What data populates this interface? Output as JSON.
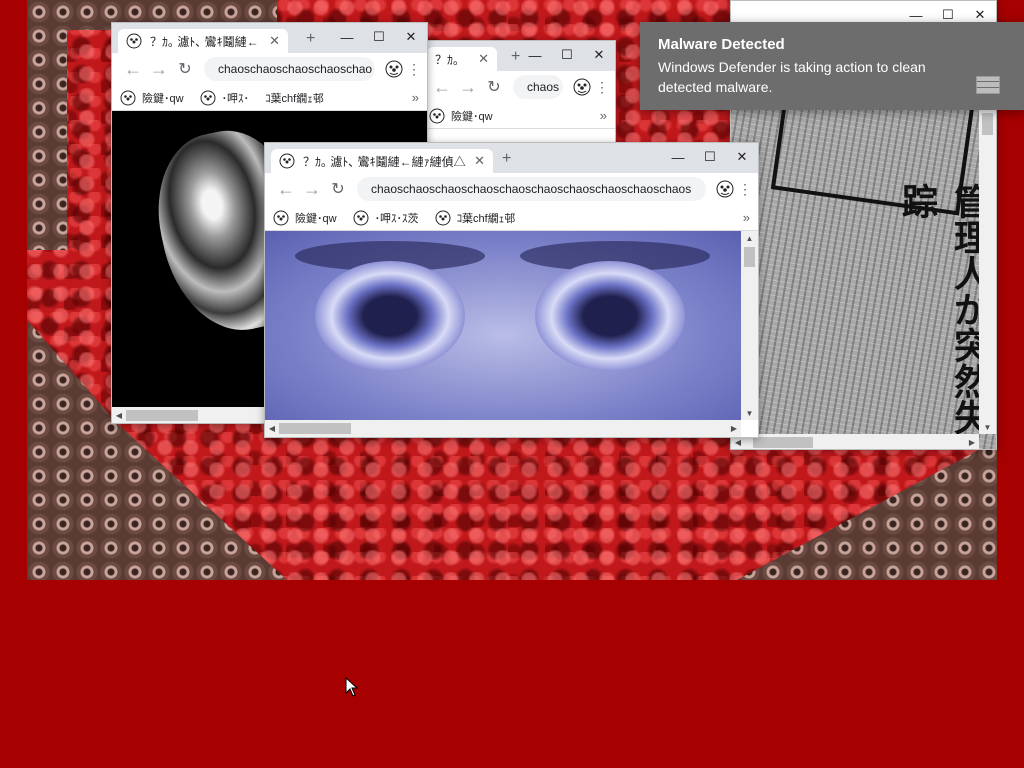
{
  "favicon_icon": "clown-face-icon",
  "windows": {
    "heart": {
      "tab_title": "？ｶ｡ 濾ﾄ､ 鸞ｷ鬮縺←",
      "url": "chaoschaoschaoschaoschao",
      "bookmarks": [
        "險鍵･qw",
        "･呷ｽ･",
        "ｺ葉chf繝ｪ邨"
      ]
    },
    "chaos_small": {
      "tab_title": "？ｶ｡",
      "url": "chaos",
      "bookmarks": [
        "險鍵･qw"
      ]
    },
    "eyes": {
      "tab_title": "？ｶ｡ 濾ﾄ､ 鸞ｷ鬮縺←縺ｧ縺偵△",
      "url": "chaoschaoschaoschaoschaoschaoschaoschaoschaoschaos",
      "bookmarks": [
        "險鍵･qw",
        "･呷ｽ･ｽ茨",
        "ｺ葉chf繝ｪ邨"
      ]
    },
    "news": {
      "headline": "管理人が突然失踪"
    }
  },
  "window_controls": {
    "minimize": "—",
    "maximize": "☐",
    "close": "✕"
  },
  "toolbar_icons": {
    "back": "←",
    "forward": "→",
    "reload": "↻",
    "menu": "⋮",
    "new_tab": "+",
    "tab_close": "✕",
    "bookmarks_more": "»"
  },
  "notification": {
    "title": "Malware Detected",
    "body": "Windows Defender is taking action to clean detected malware.",
    "icon": "firewall-brick-icon"
  },
  "colors": {
    "desktop_background": "#a60000",
    "notification_background": "#6d6d6d",
    "tab_strip": "#dee1e6"
  }
}
